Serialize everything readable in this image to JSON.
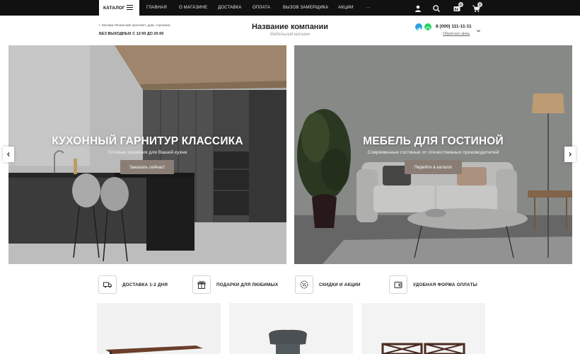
{
  "nav": {
    "catalog_label": "КАТАЛОГ",
    "items": [
      "ГЛАВНАЯ",
      "О МАГАЗИНЕ",
      "ДОСТАВКА",
      "ОПЛАТА",
      "ВЫЗОВ ЗАМЕРЩИКА",
      "АКЦИИ",
      "···"
    ],
    "icons": [
      "user-icon",
      "search-icon",
      "compare-icon",
      "cart-icon"
    ],
    "compare_count": "0",
    "cart_count": "0"
  },
  "header": {
    "address": "г. Москва Ленинский проспект, дом, строение",
    "hours": "БЕЗ ВЫХОДНЫХ С 12:00 ДО 20:00",
    "company_name": "Название компании",
    "company_subtitle": "Мебельный магазин",
    "messengers": [
      "telegram-icon",
      "whatsapp-icon"
    ],
    "phone": "8 (000) 111-11-11",
    "feedback": "Обратная связь"
  },
  "banners": [
    {
      "title": "КУХОННЫЙ ГАРНИТУР КЛАССИКА",
      "subtitle": "Готовые решения для Вашей кухни",
      "button": "Заказать сейчас!"
    },
    {
      "title": "МЕБЕЛЬ ДЛЯ ГОСТИНОЙ",
      "subtitle": "Современные гостиные от отечественных производителей",
      "button": "Перейти в каталог"
    }
  ],
  "features": [
    {
      "label": "ДОСТАВКА 1-2 ДНЯ",
      "icon": "truck-icon"
    },
    {
      "label": "ПОДАРКИ ДЛЯ ЛЮБИМЫХ",
      "icon": "gift-icon"
    },
    {
      "label": "СКИДКИ И АКЦИИ",
      "icon": "discount-icon"
    },
    {
      "label": "УДОБНАЯ ФОРМА ОПЛАТЫ",
      "icon": "wallet-icon"
    }
  ],
  "colors": {
    "nav_bg": "#111111",
    "banner_button": "#8a7d76",
    "telegram": "#2aa3e0",
    "whatsapp": "#25d366"
  }
}
